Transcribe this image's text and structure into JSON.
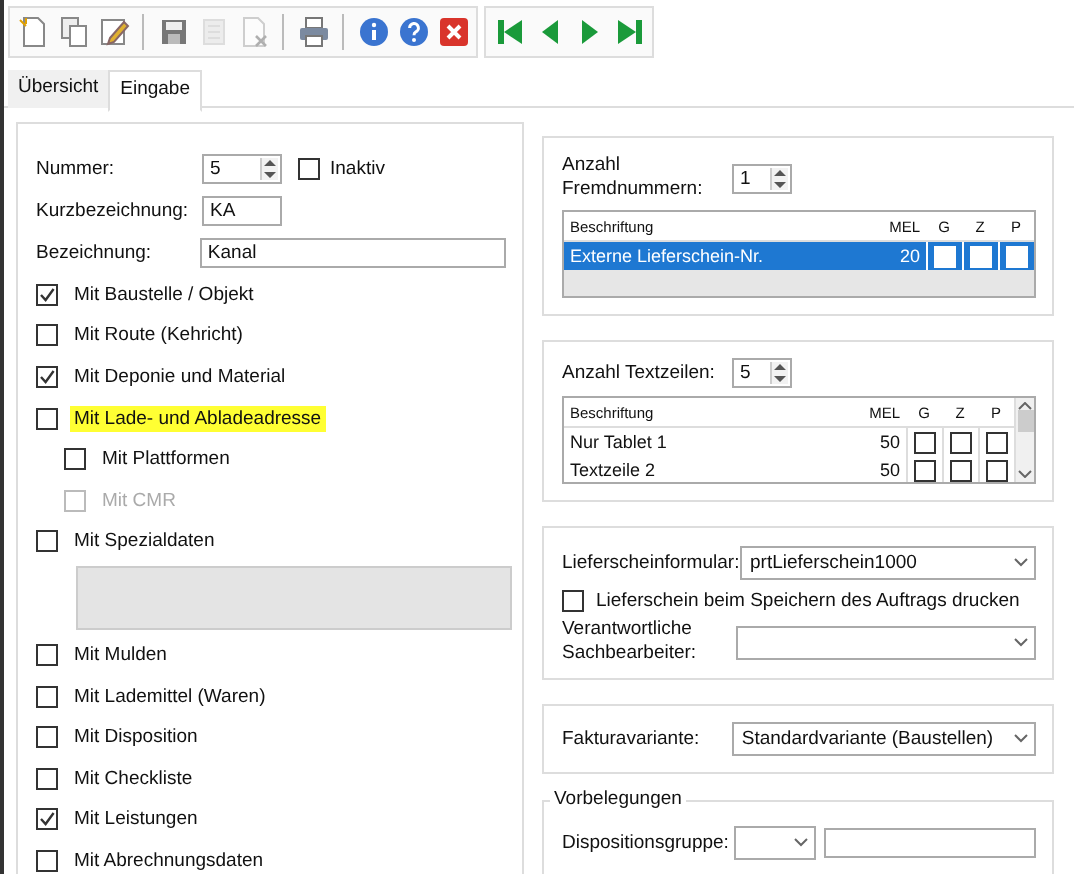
{
  "toolbar": {
    "groups": [
      [
        {
          "kind": "new",
          "disabled": false
        },
        {
          "kind": "copy",
          "disabled": false
        },
        {
          "kind": "edit",
          "disabled": false
        }
      ],
      [
        {
          "kind": "save",
          "disabled": false
        },
        {
          "kind": "delete",
          "disabled": true
        },
        {
          "kind": "discard",
          "disabled": true
        }
      ],
      [
        {
          "kind": "print",
          "disabled": false
        }
      ],
      [
        {
          "kind": "info",
          "disabled": false
        },
        {
          "kind": "help",
          "disabled": false
        },
        {
          "kind": "close",
          "disabled": false
        }
      ],
      [
        {
          "kind": "first",
          "disabled": false
        },
        {
          "kind": "prev",
          "disabled": false
        },
        {
          "kind": "next",
          "disabled": false
        },
        {
          "kind": "last",
          "disabled": false
        }
      ]
    ]
  },
  "tabs": [
    {
      "label": "Übersicht",
      "selected": false
    },
    {
      "label": "Eingabe",
      "selected": true
    }
  ],
  "general": {
    "fields": [
      {
        "kind": "spin",
        "label": "Nummer:",
        "value": "5"
      },
      {
        "kind": "text",
        "label": "Kurzbezeichnung:",
        "value": "KA"
      },
      {
        "kind": "wide",
        "label": "Bezeichnung:",
        "value": "Kanal"
      }
    ],
    "inactive": {
      "label": "Inaktiv",
      "checked": false
    },
    "options": [
      {
        "kind": "check",
        "label": "Mit Baustelle / Objekt",
        "checked": true,
        "disabled": false,
        "highlighted": false
      },
      {
        "kind": "check",
        "label": "Mit Route (Kehricht)",
        "checked": false,
        "disabled": false,
        "highlighted": false
      },
      {
        "kind": "check",
        "label": "Mit Deponie und Material",
        "checked": true,
        "disabled": false,
        "highlighted": false
      },
      {
        "kind": "check",
        "label": "Mit Lade- und Abladeadresse",
        "checked": false,
        "disabled": false,
        "highlighted": true,
        "children": [
          {
            "kind": "check",
            "label": "Mit Plattformen",
            "checked": false,
            "disabled": false,
            "highlighted": false
          },
          {
            "kind": "check",
            "label": "Mit CMR",
            "checked": false,
            "disabled": true,
            "highlighted": false
          }
        ]
      },
      {
        "kind": "check",
        "label": "Mit Spezialdaten",
        "checked": false,
        "disabled": false,
        "highlighted": false
      },
      {
        "kind": "memo",
        "disabled": true
      },
      {
        "kind": "check",
        "label": "Mit Mulden",
        "checked": false,
        "disabled": false,
        "highlighted": false
      },
      {
        "kind": "check",
        "label": "Mit Lademittel (Waren)",
        "checked": false,
        "disabled": false,
        "highlighted": false
      },
      {
        "kind": "check",
        "label": "Mit Disposition",
        "checked": false,
        "disabled": false,
        "highlighted": false
      },
      {
        "kind": "check",
        "label": "Mit Checkliste",
        "checked": false,
        "disabled": false,
        "highlighted": false
      },
      {
        "kind": "check",
        "label": "Mit Leistungen",
        "checked": true,
        "disabled": false,
        "highlighted": false
      },
      {
        "kind": "check",
        "label": "Mit Abrechnungsdaten",
        "checked": false,
        "disabled": false,
        "highlighted": false
      }
    ]
  },
  "external_numbers": {
    "label": "Anzahl Fremdnummern:",
    "value": "1",
    "columns": [
      "Beschriftung",
      "MEL",
      "G",
      "Z",
      "P"
    ],
    "scrollbar": false,
    "rows": [
      {
        "label": "Externe Lieferschein-Nr.",
        "mel": "20",
        "g": false,
        "z": false,
        "p": false,
        "selected": true
      }
    ]
  },
  "text_lines": {
    "label": "Anzahl Textzeilen:",
    "value": "5",
    "columns": [
      "Beschriftung",
      "MEL",
      "G",
      "Z",
      "P"
    ],
    "scrollbar": true,
    "rows": [
      {
        "label": "Nur Tablet 1",
        "mel": "50",
        "g": false,
        "z": false,
        "p": false,
        "selected": false
      },
      {
        "label": "Textzeile 2",
        "mel": "50",
        "g": false,
        "z": false,
        "p": false,
        "selected": false
      }
    ]
  },
  "delivery": {
    "form": {
      "label": "Lieferscheinformular:",
      "value": "prtLieferschein1000"
    },
    "print_on_save": {
      "label": "Lieferschein beim Speichern des Auftrags drucken",
      "checked": false
    },
    "responsible": {
      "label": "Verantwortliche Sachbearbeiter:"
    }
  },
  "invoicing": {
    "label": "Fakturavariante:",
    "value": "Standardvariante (Baustellen)"
  },
  "defaults": {
    "title": "Vorbelegungen",
    "label": "Dispositionsgruppe:"
  }
}
